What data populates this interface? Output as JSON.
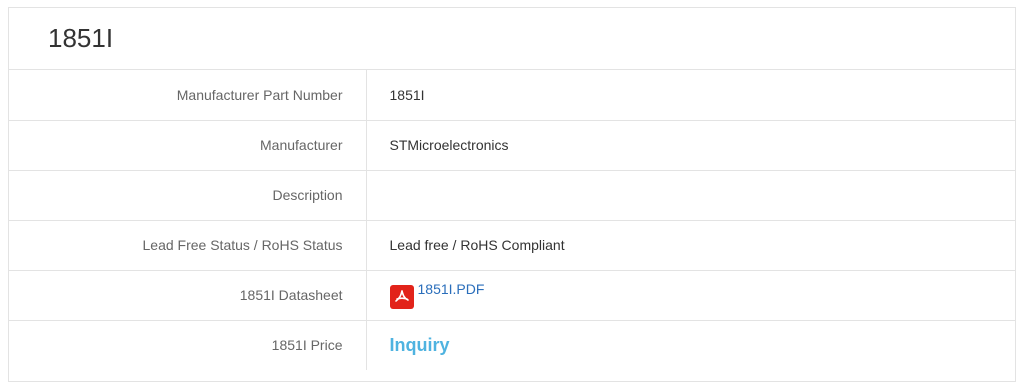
{
  "title": "1851I",
  "rows": [
    {
      "label": "Manufacturer Part Number",
      "value": "1851I"
    },
    {
      "label": "Manufacturer",
      "value": "STMicroelectronics"
    },
    {
      "label": "Description",
      "value": ""
    },
    {
      "label": "Lead Free Status / RoHS Status",
      "value": "Lead free / RoHS Compliant"
    },
    {
      "label": "1851I Datasheet",
      "value": "1851I.PDF",
      "icon": "pdf-icon"
    },
    {
      "label": "1851I Price",
      "value": "Inquiry"
    }
  ],
  "colors": {
    "link": "#2a6ebb",
    "inquiry": "#4fb3e0",
    "pdf": "#e2231a",
    "border": "#e3e3e3"
  }
}
